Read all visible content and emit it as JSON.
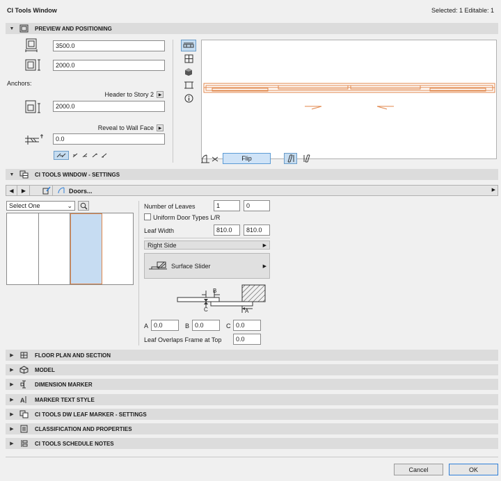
{
  "window": {
    "title": "CI Tools Window",
    "selection_info": "Selected: 1 Editable: 1"
  },
  "preview": {
    "section_title": "PREVIEW AND POSITIONING",
    "width_value": "3500.0",
    "height_value": "2000.0",
    "anchors_label": "Anchors:",
    "header_anchor": "Header to Story 2",
    "header_value": "2000.0",
    "reveal_anchor": "Reveal to Wall Face",
    "reveal_value": "0.0",
    "flip_label": "Flip"
  },
  "settings": {
    "section_title": "CI TOOLS WINDOW - SETTINGS",
    "nav_label": "Doors...",
    "select_value": "Select One",
    "leaves_label": "Number of Leaves",
    "leaves_1": "1",
    "leaves_2": "0",
    "uniform_label": "Uniform Door Types L/R",
    "leaf_width_label": "Leaf Width",
    "leaf_width_1": "810.0",
    "leaf_width_2": "810.0",
    "side_label": "Right Side",
    "slider_label": "Surface Slider",
    "diagram": {
      "b": "B",
      "c": "C",
      "a": "A"
    },
    "a_label": "A",
    "a_value": "0.0",
    "b_label": "B",
    "b_value": "0.0",
    "c_label": "C",
    "c_value": "0.0",
    "overlap_label": "Leaf Overlaps Frame at Top",
    "overlap_value": "0.0"
  },
  "collapsed_sections": [
    {
      "label": "FLOOR PLAN AND SECTION",
      "icon": "floor-plan-icon"
    },
    {
      "label": "MODEL",
      "icon": "model-icon"
    },
    {
      "label": "DIMENSION MARKER",
      "icon": "dimension-marker-icon"
    },
    {
      "label": "MARKER TEXT STYLE",
      "icon": "marker-text-icon"
    },
    {
      "label": "CI TOOLS DW LEAF MARKER - SETTINGS",
      "icon": "leaf-marker-icon"
    },
    {
      "label": "CLASSIFICATION AND PROPERTIES",
      "icon": "classification-icon"
    },
    {
      "label": "CI TOOLS SCHEDULE NOTES",
      "icon": "schedule-notes-icon"
    }
  ],
  "footer": {
    "cancel_label": "Cancel",
    "ok_label": "OK"
  },
  "colors": {
    "accent": "#5b9bd5",
    "highlight_orange": "#e0864a",
    "section_bg": "#dcdcdc"
  }
}
